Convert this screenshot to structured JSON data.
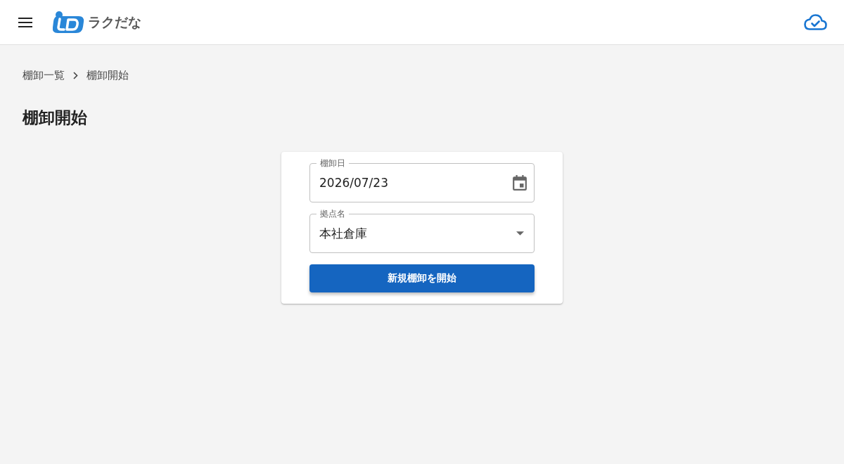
{
  "header": {
    "brand": "ラクだな"
  },
  "breadcrumb": [
    {
      "label": "棚卸一覧"
    },
    {
      "label": "棚卸開始"
    }
  ],
  "title": "棚卸開始",
  "form": {
    "fields": [
      {
        "kind": "date",
        "label": "棚卸日",
        "value": "2026/07/23"
      },
      {
        "kind": "select",
        "label": "拠点名",
        "value": "本社倉庫"
      }
    ],
    "submit": "新規棚卸を開始"
  }
}
